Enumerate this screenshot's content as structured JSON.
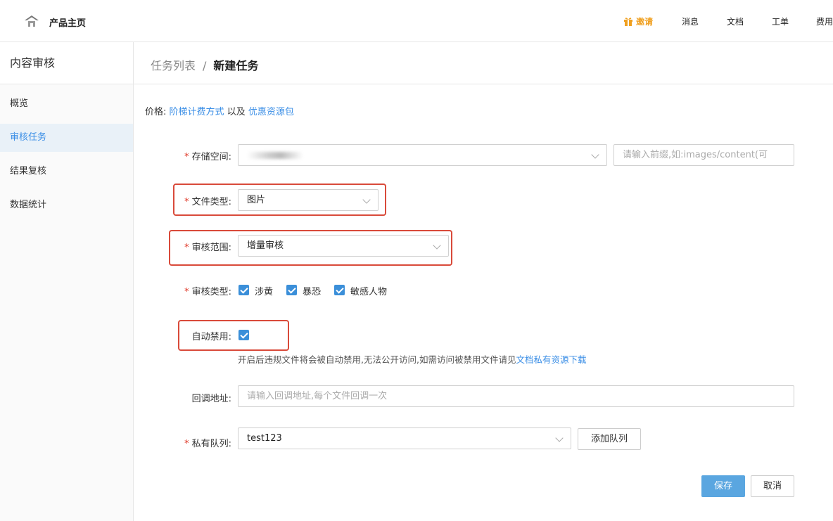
{
  "topbar": {
    "brand": "产品主页",
    "nav": {
      "invite": "邀请",
      "messages": "消息",
      "docs": "文档",
      "tickets": "工单",
      "billing": "费用"
    }
  },
  "sidebar": {
    "title": "内容审核",
    "items": [
      {
        "label": "概览"
      },
      {
        "label": "审核任务"
      },
      {
        "label": "结果复核"
      },
      {
        "label": "数据统计"
      }
    ]
  },
  "breadcrumb": {
    "parent": "任务列表",
    "separator": "/",
    "current": "新建任务"
  },
  "price": {
    "prefix": "价格:",
    "link1": "阶梯计费方式",
    "middle": "以及",
    "link2": "优惠资源包"
  },
  "form": {
    "storage": {
      "label": "存储空间:",
      "prefix_placeholder": "请输入前缀,如:images/content(可"
    },
    "file_type": {
      "label": "文件类型:",
      "value": "图片"
    },
    "scope": {
      "label": "审核范围:",
      "value": "增量审核"
    },
    "audit_type": {
      "label": "审核类型:",
      "options": [
        "涉黄",
        "暴恐",
        "敏感人物"
      ]
    },
    "auto_ban": {
      "label": "自动禁用:",
      "hint": "开启后违规文件将会被自动禁用,无法公开访问,如需访问被禁用文件请见",
      "hint_link": "文档私有资源下载"
    },
    "callback": {
      "label": "回调地址:",
      "placeholder": "请输入回调地址,每个文件回调一次"
    },
    "queue": {
      "label": "私有队列:",
      "value": "test123",
      "add_button": "添加队列"
    }
  },
  "actions": {
    "save": "保存",
    "cancel": "取消"
  },
  "colors": {
    "accent": "#3a8ee6",
    "primary_button": "#5aa6e0",
    "required": "#e03a2a",
    "highlight": "#d94a3a",
    "invite": "#f0a020"
  }
}
